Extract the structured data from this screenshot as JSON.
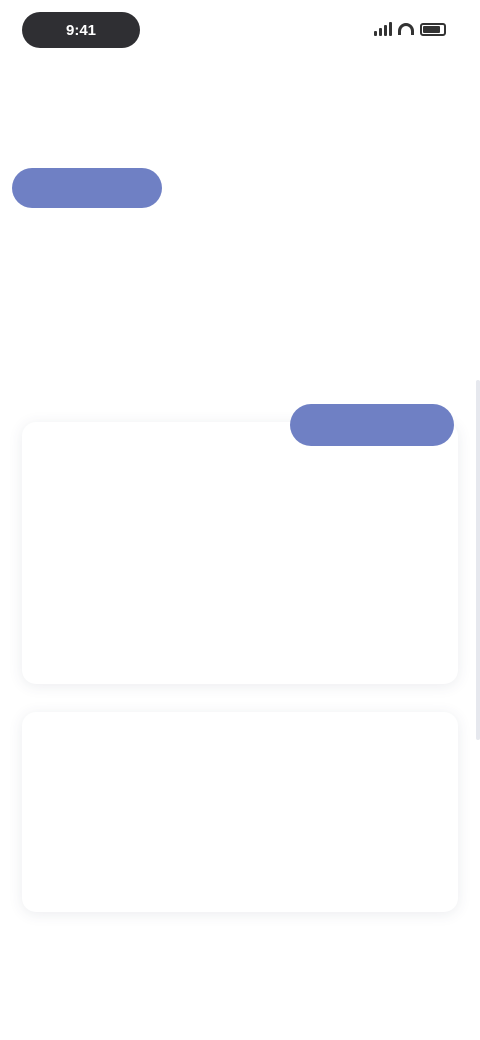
{
  "status_bar": {
    "time": "9:41",
    "battery_level": 0.85
  },
  "brand": {
    "name": ""
  },
  "tabs": [
    {
      "label": "",
      "active": true
    },
    {
      "label": "",
      "active": false
    },
    {
      "label": "",
      "active": false
    }
  ],
  "page": {
    "title": "",
    "description": ""
  },
  "primary_button": {
    "label": ""
  },
  "cards": [
    {
      "title": "",
      "subtitle": "",
      "links": [
        "",
        ""
      ],
      "meta": "",
      "action": ""
    },
    {
      "title": "",
      "subtitle": "",
      "links": [
        ""
      ],
      "meta": "",
      "action": ""
    }
  ],
  "bottom_link": {
    "label": ""
  },
  "colors": {
    "accent": "#6f80c4",
    "teal": "#2d9c8c",
    "text": "#333842",
    "muted": "#7d818c"
  }
}
